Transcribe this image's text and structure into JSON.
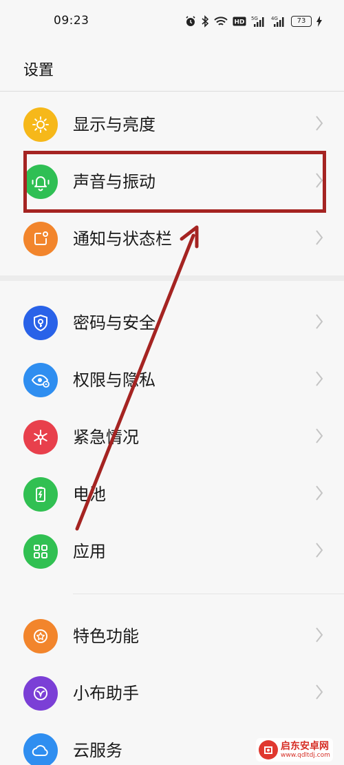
{
  "status_bar": {
    "time": "09:23",
    "battery": "73",
    "icons": [
      "alarm-icon",
      "bluetooth-icon",
      "wifi-icon",
      "hd-icon",
      "signal-5g-icon",
      "signal-4g-icon",
      "battery-icon",
      "charging-icon"
    ],
    "hd_label": "HD",
    "net1_label": "5G",
    "net2_label": "4G"
  },
  "header": {
    "title": "设置"
  },
  "sections": [
    {
      "items": [
        {
          "label": "显示与亮度",
          "icon": "sun-icon",
          "color": "#f6b81a"
        },
        {
          "label": "声音与振动",
          "icon": "bell-icon",
          "color": "#2fbf54"
        },
        {
          "label": "通知与状态栏",
          "icon": "notification-icon",
          "color": "#f2852c"
        }
      ]
    },
    {
      "items": [
        {
          "label": "密码与安全",
          "icon": "shield-key-icon",
          "color": "#2962e8"
        },
        {
          "label": "权限与隐私",
          "icon": "privacy-eye-icon",
          "color": "#2f8ef0"
        },
        {
          "label": "紧急情况",
          "icon": "emergency-asterisk-icon",
          "color": "#e8404c"
        },
        {
          "label": "电池",
          "icon": "battery-icon",
          "color": "#31c052"
        },
        {
          "label": "应用",
          "icon": "apps-grid-icon",
          "color": "#31c052"
        }
      ]
    },
    {
      "items": [
        {
          "label": "特色功能",
          "icon": "star-badge-icon",
          "color": "#f2852c"
        },
        {
          "label": "小布助手",
          "icon": "assistant-icon",
          "color": "#7b3fd6"
        },
        {
          "label": "云服务",
          "icon": "cloud-icon",
          "color": "#2f8ef0"
        }
      ]
    }
  ],
  "annotation": {
    "highlighted_item": "声音与振动",
    "color": "#a52422"
  },
  "watermark": {
    "title": "启东安卓网",
    "url": "www.qdltdj.com"
  }
}
